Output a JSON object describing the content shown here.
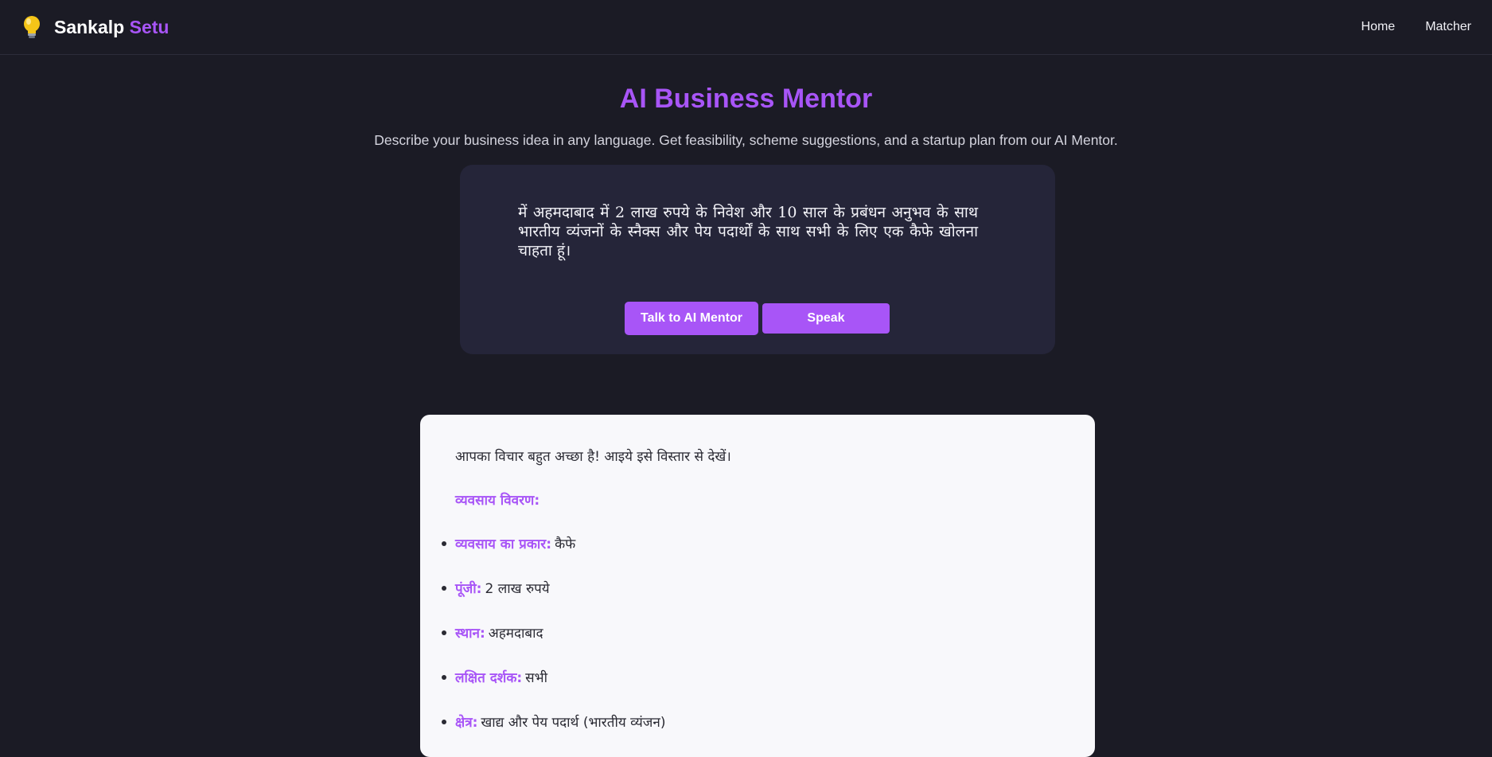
{
  "nav": {
    "brand_main": "Sankalp",
    "brand_accent": "Setu",
    "links": [
      "Home",
      "Matcher"
    ]
  },
  "hero": {
    "title": "AI Business Mentor",
    "subtitle": "Describe your business idea in any language. Get feasibility, scheme suggestions, and a startup plan from our AI Mentor."
  },
  "input": {
    "idea_text": "में अहमदाबाद में 2 लाख रुपये के निवेश और 10 साल के प्रबंधन अनुभव के साथ भारतीय व्यंजनों के स्नैक्स और पेय पदार्थों के साथ सभी के लिए एक कैफे खोलना चाहता हूं।",
    "talk_button": "Talk to AI Mentor",
    "speak_button": "Speak"
  },
  "response": {
    "intro": "आपका विचार बहुत अच्छा है! आइये इसे विस्तार से देखें।",
    "section_title": "व्यवसाय विवरण:",
    "items": [
      {
        "key": "व्यवसाय का प्रकार:",
        "value": "कैफे"
      },
      {
        "key": "पूंजी:",
        "value": "2 लाख रुपये"
      },
      {
        "key": "स्थान:",
        "value": "अहमदाबाद"
      },
      {
        "key": "लक्षित दर्शक:",
        "value": "सभी"
      },
      {
        "key": "क्षेत्र:",
        "value": "खाद्य और पेय पदार्थ (भारतीय व्यंजन)"
      }
    ]
  },
  "colors": {
    "accent": "#a855f7",
    "background": "#1b1b25",
    "card": "#252539",
    "response_bg": "#f8f8fb"
  },
  "icons": {
    "brand": "lightbulb-icon"
  }
}
